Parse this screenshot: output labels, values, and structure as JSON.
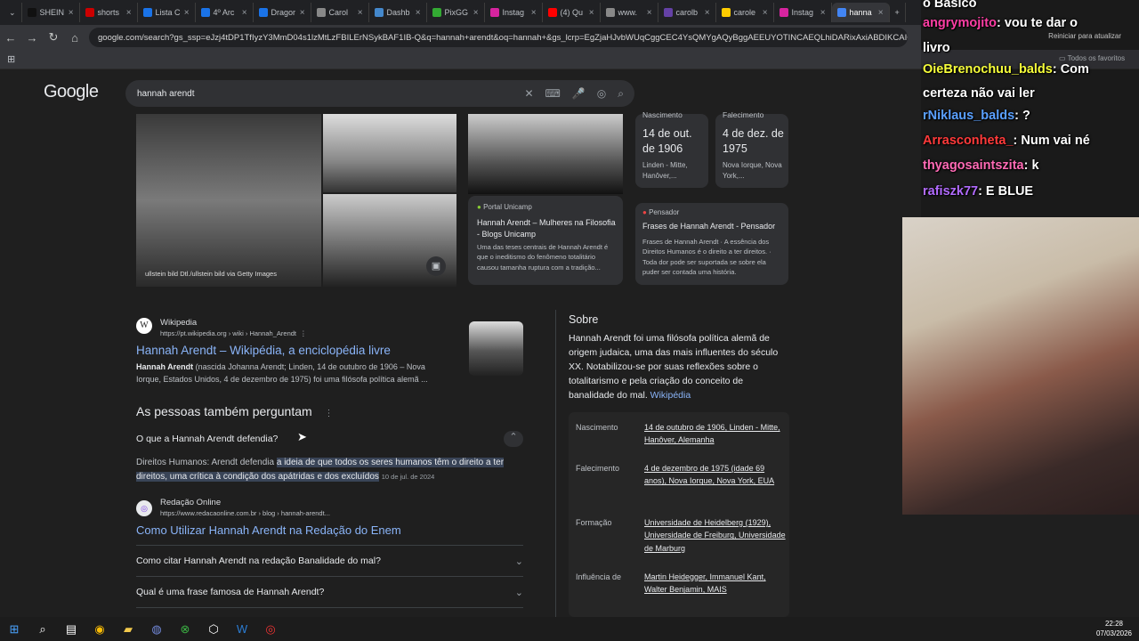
{
  "browser": {
    "tabs": [
      {
        "label": "SHEIN",
        "color": "#111"
      },
      {
        "label": "shorts",
        "color": "#c00"
      },
      {
        "label": "Lista C",
        "color": "#1a73e8"
      },
      {
        "label": "4º Arc",
        "color": "#1a73e8"
      },
      {
        "label": "Dragor",
        "color": "#1a73e8"
      },
      {
        "label": "Carol",
        "color": "#888"
      },
      {
        "label": "Dashb",
        "color": "#48c"
      },
      {
        "label": "PixGG",
        "color": "#3a3"
      },
      {
        "label": "Instag",
        "color": "#d6249f"
      },
      {
        "label": "(4) Qu",
        "color": "#f00"
      },
      {
        "label": "www.",
        "color": "#888"
      },
      {
        "label": "carolb",
        "color": "#6441a5"
      },
      {
        "label": "carole",
        "color": "#fc0"
      },
      {
        "label": "Instag",
        "color": "#d6249f"
      },
      {
        "label": "hanna",
        "color": "#4285f4",
        "active": true
      }
    ],
    "url": "google.com/search?gs_ssp=eJzj4tDP1TfIyzY3MmD04s1lzMtLzFBILErNSykBAF1IB-Q&q=hannah+arendt&oq=hannah+&gs_lcrp=EgZjaHJvbWUqCggCEC4YsQMYgAQyBggAEEUYOTINCAEQLhiDARixAxiABDIKCAIQLhixA",
    "reload_hint": "Reiniciar para atualizar",
    "bookmarks_all": "Todos os favoritos"
  },
  "chat": [
    {
      "user": "angrymojito",
      "text": ": vou te dar o",
      "color": "#ff3ea5"
    },
    {
      "user": "",
      "text": "livro",
      "color": "#fff"
    },
    {
      "user": "OieBrenochuu_balds",
      "text": ": Com",
      "color": "#f7ff3a"
    },
    {
      "user": "",
      "text": "certeza não vai ler",
      "color": "#fff"
    },
    {
      "user": "rNiklaus_balds",
      "text": ": ?",
      "color": "#5aa0ff"
    },
    {
      "user": "Arrasconheta_",
      "text": ": Num vai né",
      "color": "#ff3a3a"
    },
    {
      "user": "thyagosaintszita",
      "text": ": k",
      "color": "#ff6ab5"
    },
    {
      "user": "rafiszk77",
      "text": ": E BLUE",
      "color": "#b26bff"
    }
  ],
  "chat_top": "o Basico",
  "google": {
    "logo": "Google",
    "query": "hannah arendt",
    "image_credit": "ullstein bild Dtl./ullstein bild via Getty Images",
    "birth_card": {
      "label": "Nascimento",
      "date": "14 de out. de 1906",
      "place": "Linden - Mitte, Hanôver,..."
    },
    "death_card": {
      "label": "Falecimento",
      "date": "4 de dez. de 1975",
      "place": "Nova Iorque, Nova York,..."
    },
    "unicamp": {
      "source": "Portal Unicamp",
      "title": "Hannah Arendt – Mulheres na Filosofia - Blogs Unicamp",
      "snippet": "Uma das teses centrais de Hannah Arendt é que o ineditismo do fenômeno totalitário causou tamanha ruptura com a tradição..."
    },
    "pensador": {
      "source": "Pensador",
      "title": "Frases de Hannah Arendt - Pensador",
      "snippet": "Frases de Hannah Arendt · A essência dos Direitos Humanos é o direito a ter direitos. · Toda dor pode ser suportada se sobre ela puder ser contada uma história."
    },
    "wiki": {
      "site": "Wikipedia",
      "url": "https://pt.wikipedia.org › wiki › Hannah_Arendt",
      "title": "Hannah Arendt – Wikipédia, a enciclopédia livre",
      "snippet_bold": "Hannah Arendt",
      "snippet": " (nascida Johanna Arendt; Linden, 14 de outubro de 1906 – Nova Iorque, Estados Unidos, 4 de dezembro de 1975) foi uma filósofa política alemã ..."
    },
    "paa": {
      "heading": "As pessoas também perguntam",
      "q1": "O que a Hannah Arendt defendia?",
      "a1_plain": "Direitos Humanos: Arendt defendia ",
      "a1_highlight": "a ideia de que todos os seres humanos têm o direito a ter direitos, uma crítica à condição dos apátridas e dos excluídos",
      "a1_date": "10 de jul. de 2024",
      "src_site": "Redação Online",
      "src_url": "https://www.redacaonline.com.br › blog › hannah-arendt...",
      "src_title": "Como Utilizar Hannah Arendt na Redação do Enem",
      "q2": "Como citar Hannah Arendt na redação Banalidade do mal?",
      "q3": "Qual é uma frase famosa de Hannah Arendt?"
    },
    "about": {
      "heading": "Sobre",
      "text": "Hannah Arendt foi uma filósofa política alemã de origem judaica, uma das mais influentes do século XX. Notabilizou-se por suas reflexões sobre o totalitarismo e pela criação do conceito de banalidade do mal.",
      "source": "Wikipédia",
      "facts": [
        {
          "k": "Nascimento",
          "v": "14 de outubro de 1906, Linden - Mitte, Hanôver, Alemanha"
        },
        {
          "k": "Falecimento",
          "v": "4 de dezembro de 1975 (idade 69 anos), Nova Iorque, Nova York, EUA"
        },
        {
          "k": "Formação",
          "v": "Universidade de Heidelberg (1929), Universidade de Freiburg, Universidade de Marburg"
        },
        {
          "k": "Influência de",
          "v": "Martin Heidegger, Immanuel Kant, Walter Benjamin, MAIS"
        }
      ]
    }
  },
  "taskbar": {
    "time": "22:28",
    "date": "07/03/2026"
  }
}
